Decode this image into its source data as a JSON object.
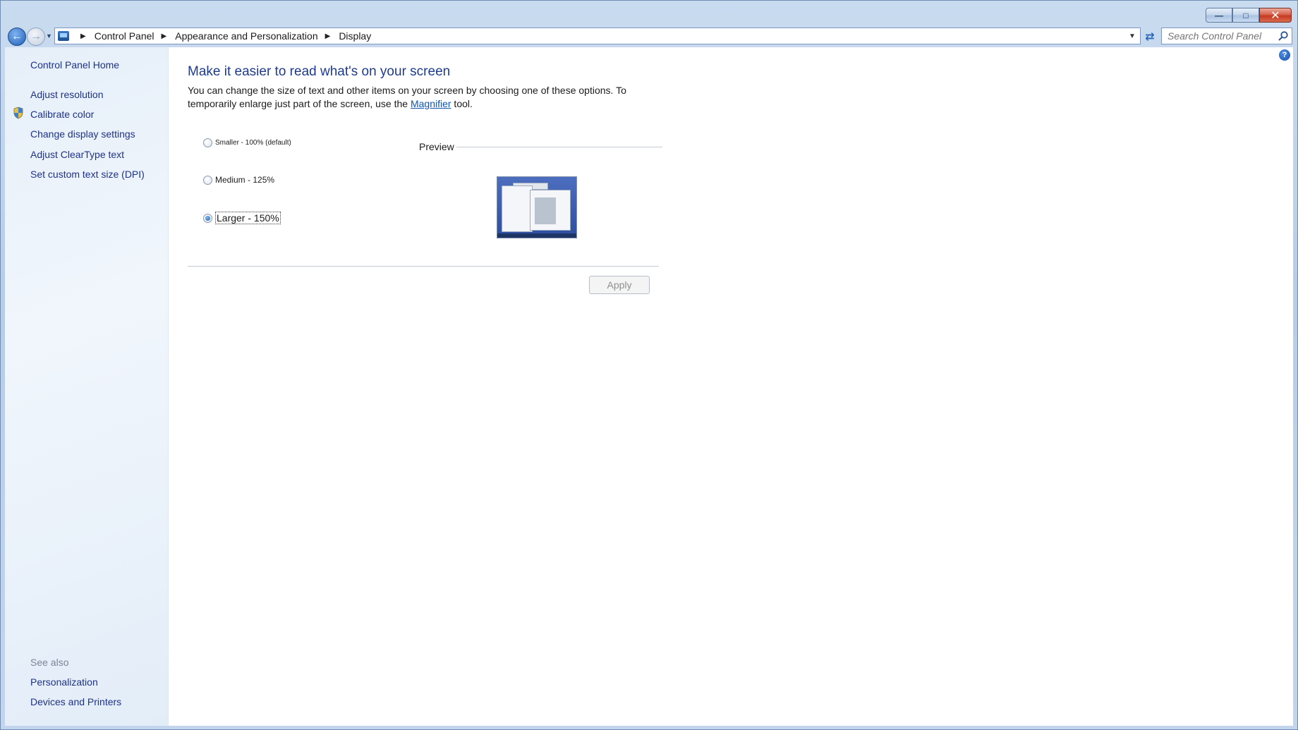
{
  "window": {
    "controls": {
      "minimize": "—",
      "maximize": "□",
      "close": "✕"
    }
  },
  "address": {
    "breadcrumbs": [
      "Control Panel",
      "Appearance and Personalization",
      "Display"
    ],
    "search_placeholder": "Search Control Panel"
  },
  "sidebar": {
    "home": "Control Panel Home",
    "links": [
      "Adjust resolution",
      "Calibrate color",
      "Change display settings",
      "Adjust ClearType text",
      "Set custom text size (DPI)"
    ],
    "see_also_title": "See also",
    "see_also": [
      "Personalization",
      "Devices and Printers"
    ]
  },
  "main": {
    "title": "Make it easier to read what's on your screen",
    "description_before": "You can change the size of text and other items on your screen by choosing one of these options. To temporarily enlarge just part of the screen, use the ",
    "description_link": "Magnifier",
    "description_after": " tool.",
    "options": [
      {
        "label": "Smaller - 100% (default)",
        "checked": false
      },
      {
        "label": "Medium - 125%",
        "checked": false
      },
      {
        "label": "Larger - 150%",
        "checked": true
      }
    ],
    "preview_label": "Preview",
    "apply_label": "Apply"
  },
  "colors": {
    "title": "#1e3b8f",
    "link": "#1e3287",
    "hyperlink": "#0b54b4"
  }
}
